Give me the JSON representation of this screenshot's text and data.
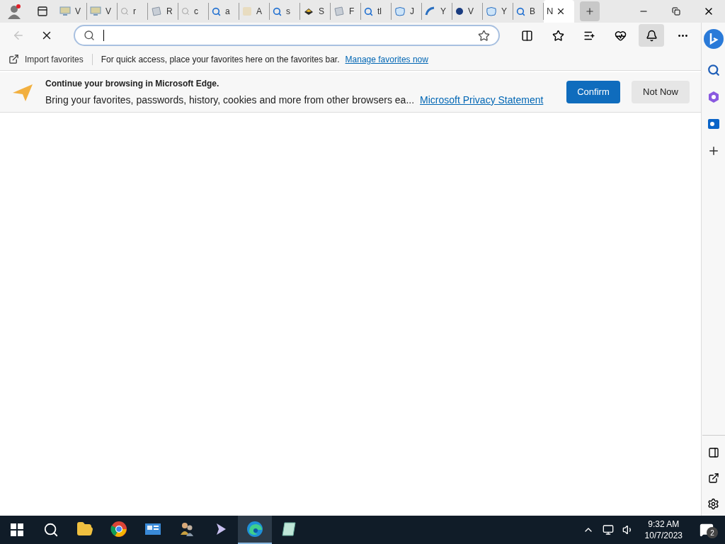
{
  "tabs": [
    {
      "label": "V",
      "kind": "monitor",
      "selected": false
    },
    {
      "label": "V",
      "kind": "monitor",
      "selected": false
    },
    {
      "label": "r",
      "kind": "search-faint",
      "selected": false
    },
    {
      "label": "R",
      "kind": "page",
      "selected": false
    },
    {
      "label": "c",
      "kind": "search-faint",
      "selected": false
    },
    {
      "label": "a",
      "kind": "search",
      "selected": false
    },
    {
      "label": "A",
      "kind": "letter",
      "selected": false
    },
    {
      "label": "s",
      "kind": "search",
      "selected": false
    },
    {
      "label": "S",
      "kind": "cube",
      "selected": false
    },
    {
      "label": "F",
      "kind": "page",
      "selected": false
    },
    {
      "label": "tl",
      "kind": "search",
      "selected": false
    },
    {
      "label": "J",
      "kind": "blob",
      "selected": false
    },
    {
      "label": "Y",
      "kind": "arc",
      "selected": false
    },
    {
      "label": "V",
      "kind": "dot",
      "selected": false
    },
    {
      "label": "Y",
      "kind": "blob",
      "selected": false
    },
    {
      "label": "B",
      "kind": "search",
      "selected": false
    },
    {
      "label": "N",
      "kind": "none",
      "selected": true
    }
  ],
  "favorites_bar": {
    "import": "Import favorites",
    "hint": "For quick access, place your favorites here on the favorites bar.",
    "link": "Manage favorites now"
  },
  "infobar": {
    "title": "Continue your browsing in Microsoft Edge.",
    "body": "Bring your favorites, passwords, history, cookies and more from other browsers ea...",
    "link": "Microsoft Privacy Statement",
    "confirm": "Confirm",
    "dismiss": "Not Now"
  },
  "taskbar": {
    "apps": [
      {
        "kind": "folder",
        "selected": false
      },
      {
        "kind": "chrome",
        "selected": false
      },
      {
        "kind": "panel",
        "selected": false
      },
      {
        "kind": "people",
        "selected": false
      },
      {
        "kind": "arrow",
        "selected": false
      },
      {
        "kind": "edge",
        "selected": true
      },
      {
        "kind": "notepad",
        "selected": false
      }
    ],
    "time": "9:32 AM",
    "date": "10/7/2023",
    "notifications": "2"
  }
}
